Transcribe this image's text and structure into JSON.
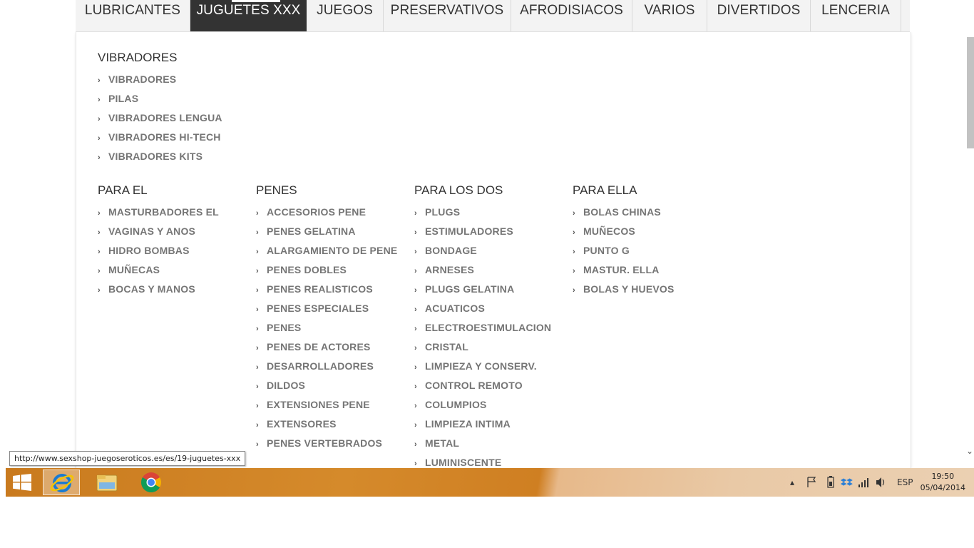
{
  "nav": {
    "items": [
      {
        "label": "LUBRICANTES"
      },
      {
        "label": "JUGUETES XXX"
      },
      {
        "label": "JUEGOS"
      },
      {
        "label": "PRESERVATIVOS"
      },
      {
        "label": "AFRODISIACOS"
      },
      {
        "label": "VARIOS"
      },
      {
        "label": "DIVERTIDOS"
      },
      {
        "label": "LENCERIA"
      }
    ],
    "active_index": 1
  },
  "menu": {
    "vibradores": {
      "title": "VIBRADORES",
      "items": [
        "VIBRADORES",
        "PILAS",
        "VIBRADORES LENGUA",
        "VIBRADORES HI-TECH",
        "VIBRADORES KITS"
      ]
    },
    "para_el": {
      "title": "PARA EL",
      "items": [
        "MASTURBADORES EL",
        "VAGINAS Y ANOS",
        "HIDRO BOMBAS",
        "MUÑECAS",
        "BOCAS Y MANOS"
      ]
    },
    "penes": {
      "title": "PENES",
      "items": [
        "ACCESORIOS PENE",
        "PENES GELATINA",
        "ALARGAMIENTO DE PENE",
        "PENES DOBLES",
        "PENES REALISTICOS",
        "PENES ESPECIALES",
        "PENES",
        "PENES DE ACTORES",
        "DESARROLLADORES",
        "DILDOS",
        "EXTENSIONES PENE",
        "EXTENSORES",
        "PENES VERTEBRADOS"
      ]
    },
    "para_los_dos": {
      "title": "PARA LOS DOS",
      "items": [
        "PLUGS",
        "ESTIMULADORES",
        "BONDAGE",
        "ARNESES",
        "PLUGS GELATINA",
        "ACUATICOS",
        "ELECTROESTIMULACION",
        "CRISTAL",
        "LIMPIEZA Y CONSERV.",
        "CONTROL REMOTO",
        "COLUMPIOS",
        "LIMPIEZA INTIMA",
        "METAL",
        "LUMINISCENTE"
      ]
    },
    "para_ella": {
      "title": "PARA ELLA",
      "items": [
        "BOLAS CHINAS",
        "MUÑECOS",
        "PUNTO G",
        "MASTUR. ELLA",
        "BOLAS Y HUEVOS"
      ]
    }
  },
  "status_url": "http://www.sexshop-juegoseroticos.es/es/19-juguetes-xxx",
  "taskbar": {
    "apps": [
      {
        "icon": "internet-explorer-icon",
        "active": true
      },
      {
        "icon": "file-explorer-icon",
        "active": false
      },
      {
        "icon": "chrome-icon",
        "active": false
      }
    ],
    "language": "ESP",
    "time": "19:50",
    "date": "05/04/2014"
  },
  "colors": {
    "nav_active_bg": "#333333",
    "link_text": "#757575",
    "heading_text": "#333333"
  }
}
